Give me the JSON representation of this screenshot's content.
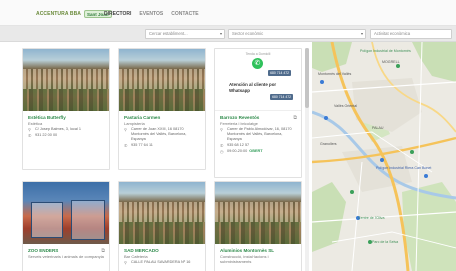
{
  "header": {
    "brand_text": "ACCENTURA BBA",
    "brand_logo": "Sant Joan",
    "nav": [
      {
        "label": "DIRECTORI",
        "active": true
      },
      {
        "label": "EVENTOS",
        "active": false
      },
      {
        "label": "CONTACTE",
        "active": false
      }
    ]
  },
  "filters": {
    "search_placeholder": "Cercar establiment...",
    "sector_placeholder": "Sector econòmic",
    "activity_placeholder": "Activitat econòmica"
  },
  "cards": [
    {
      "name": "Estètica Butterfly",
      "category": "Estètica",
      "address": "C/ Josep Balmes, 3, local 1",
      "phone": "931 22 00 00"
    },
    {
      "name": "Pastaria Carmen",
      "category": "Lampisteria",
      "address": "Carrer de Joan XXIII, 16 08170 Montornès del Vallès, Barcelona, Espanya",
      "phone": "935 77 64 11"
    },
    {
      "name": "Barrozo Reventós",
      "category": "Ferreteria i bricolatge",
      "address": "Carrer de Pablo Almodóvar, 16, 08170 Montornès del Vallès, Barcelona, Espanya",
      "phone": "935 68 12 57",
      "hours": "09:00-20:00",
      "open_label": "OBERT",
      "wa_top": "Tenda a Domicili",
      "wa_number": "680 714 472",
      "wa_title": "Atención al cliente por Whatsapp",
      "wa_number2": "680 714 472"
    },
    {
      "name": "ZOO ENDERS",
      "category": "Serveis veterinaris i animals de companyia",
      "address": ""
    },
    {
      "name": "SAD MERCADO",
      "category": "Bar Cafeteria",
      "address": "CALLE PALAU SAVARDERA Nº 16"
    },
    {
      "name": "Aluminios Montornès SL",
      "category": "Construcció, instal·lacions i subministraments",
      "address": ""
    }
  ],
  "map": {
    "labels": [
      "Polígon Industrial de Montornès",
      "MOGRELL",
      "Montornès del Vallès",
      "Vallès Oriental",
      "PALAU",
      "Granollers",
      "Centre de l'Oliva",
      "Parc de la Selva",
      "Polígon Industrial Riera Can Bonet"
    ]
  }
}
